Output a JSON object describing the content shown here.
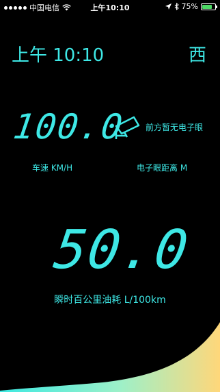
{
  "status_bar": {
    "carrier": "中国电信",
    "time": "上午10:10",
    "battery": "75%",
    "battery_level": 0.75,
    "icons": [
      "signal-dots-icon",
      "wifi-icon",
      "location-arrow-icon",
      "bluetooth-icon",
      "battery-icon"
    ]
  },
  "header": {
    "time": "上午 10:10",
    "direction": "西"
  },
  "speed": {
    "value": "100.0",
    "label": "车速 KM/H"
  },
  "camera": {
    "icon": "speed-camera-icon",
    "status": "前方暂无电子眼",
    "distance_label": "电子眼距离 M"
  },
  "fuel": {
    "value": "50.0",
    "label": "瞬时百公里油耗 L/100km"
  },
  "colors": {
    "accent": "#3ee8e6",
    "background": "#000000",
    "battery_fill": "#4cd964",
    "wave_start": "#3de9e1",
    "wave_end": "#ffd77a"
  }
}
